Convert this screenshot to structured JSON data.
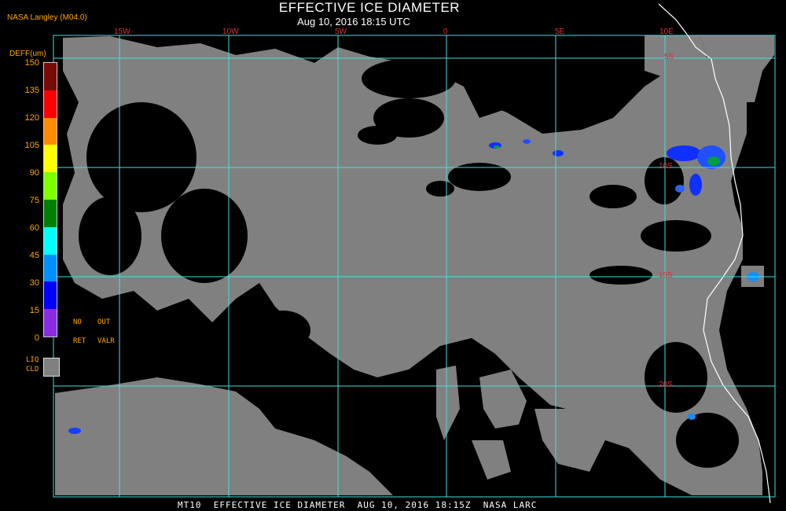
{
  "header": {
    "title": "EFFECTIVE ICE DIAMETER",
    "subtitle": "Aug 10, 2016 18:15 UTC",
    "provider": "NASA Langley (M04.0)"
  },
  "footer": {
    "caption": "MT10  EFFECTIVE ICE DIAMETER  AUG 10, 2016 18:15Z  NASA LARC"
  },
  "map": {
    "longitude_labels": [
      "15W",
      "10W",
      "5W",
      "0",
      "5E",
      "10E"
    ],
    "latitude_labels": [
      "5S",
      "10S",
      "15S",
      "20S"
    ],
    "colors": {
      "background": "#000000",
      "liquid_cloud": "#808080",
      "grid": "#40e0e0",
      "coastline": "#ffffff",
      "labels": "#e03030"
    }
  },
  "legend": {
    "title": "DEFF(um)",
    "ticks": [
      "150",
      "135",
      "120",
      "105",
      "90",
      "75",
      "60",
      "45",
      "30",
      "15",
      "0"
    ],
    "colors": [
      "#7a0a0a",
      "#ff0000",
      "#ff8c00",
      "#ffff00",
      "#80ff00",
      "#008000",
      "#00ffff",
      "#0090ff",
      "#0000ff",
      "#8a2be2"
    ],
    "no_ret": [
      "NO",
      "RET"
    ],
    "out_valr": [
      "OUT",
      "VALR"
    ],
    "liq_cld": [
      "LIQ",
      "CLD"
    ]
  }
}
